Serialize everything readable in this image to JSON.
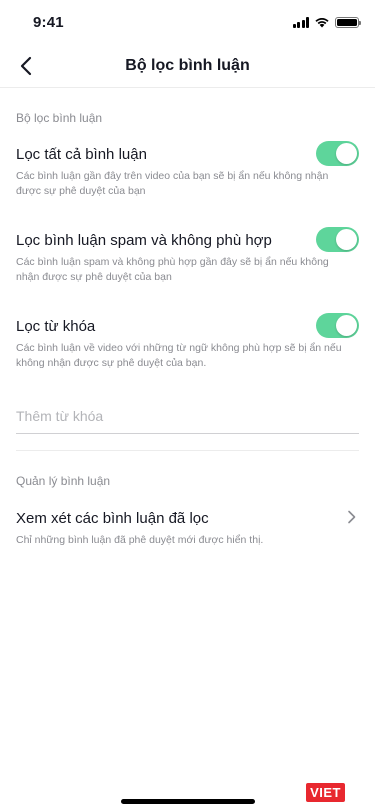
{
  "status_bar": {
    "time": "9:41"
  },
  "nav": {
    "title": "Bộ lọc bình luận",
    "back_icon": "chevron-left-icon"
  },
  "filter_section": {
    "header": "Bộ lọc bình luận",
    "items": [
      {
        "title": "Lọc tất cả bình luận",
        "description": "Các bình luận gần đây trên video của bạn sẽ bị ẩn nếu không nhận được sự phê duyệt của bạn",
        "enabled": true
      },
      {
        "title": "Lọc bình luận spam và không phù hợp",
        "description": "Các bình luận spam và không phù hợp gần đây sẽ bị ẩn nếu không nhận được sự phê duyệt của bạn",
        "enabled": true
      },
      {
        "title": "Lọc từ khóa",
        "description": "Các bình luận về video với những từ ngữ không phù hợp sẽ bị ẩn nếu không nhận được sự phê duyệt của bạn.",
        "enabled": true
      }
    ],
    "keyword_placeholder": "Thêm từ khóa"
  },
  "manage_section": {
    "header": "Quản lý bình luận",
    "review": {
      "title": "Xem xét các bình luận đã lọc",
      "description": "Chỉ những bình luận đã phê duyệt mới được hiển thị."
    }
  },
  "watermark": "VIET",
  "colors": {
    "toggle_on": "#5ed59b",
    "text_primary": "#161823",
    "text_secondary": "#8a8b91"
  }
}
